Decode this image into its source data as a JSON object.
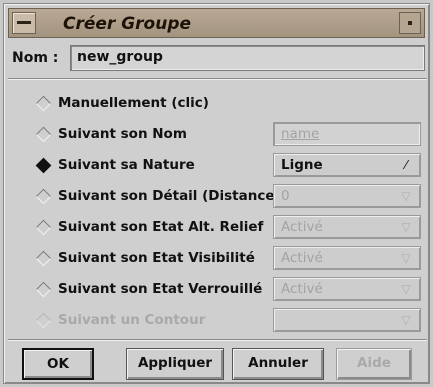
{
  "window": {
    "title": "Créer Groupe"
  },
  "name_field": {
    "label": "Nom :",
    "value": "new_group"
  },
  "options": [
    {
      "label": "Manuellement (clic)",
      "selected": false,
      "enabled": true
    },
    {
      "label": "Suivant son Nom",
      "selected": false,
      "enabled": true,
      "control": "name"
    },
    {
      "label": "Suivant sa Nature",
      "selected": true,
      "enabled": true,
      "control": "Ligne"
    },
    {
      "label": "Suivant son Détail (Distance)",
      "selected": false,
      "enabled": true,
      "control": "0"
    },
    {
      "label": "Suivant son Etat Alt. Relief",
      "selected": false,
      "enabled": true,
      "control": "Activé"
    },
    {
      "label": "Suivant son Etat Visibilité",
      "selected": false,
      "enabled": true,
      "control": "Activé"
    },
    {
      "label": "Suivant son Etat Verrouillé",
      "selected": false,
      "enabled": true,
      "control": "Activé"
    },
    {
      "label": "Suivant un Contour",
      "selected": false,
      "enabled": false,
      "control": ""
    }
  ],
  "buttons": {
    "ok": "OK",
    "apply": "Appliquer",
    "cancel": "Annuler",
    "help": "Aide"
  }
}
